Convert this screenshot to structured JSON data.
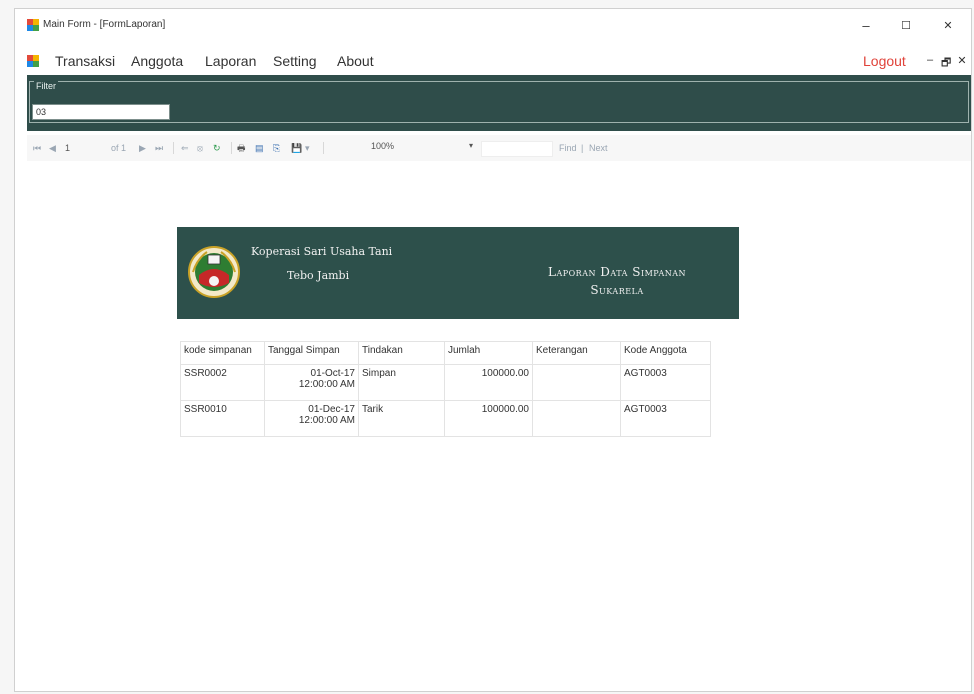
{
  "window": {
    "title": "Main Form - [FormLaporan]",
    "controls": {
      "minimize": "‒",
      "maximize": "☐",
      "close": "✕"
    }
  },
  "menu": {
    "items": [
      "Transaksi",
      "Anggota",
      "Laporan",
      "Setting",
      "About"
    ],
    "logout": "Logout",
    "mdi_controls": [
      "‒",
      "🗗",
      "✕"
    ]
  },
  "filter": {
    "label": "Filter",
    "value": "03"
  },
  "toolbar": {
    "first": "⏮",
    "prev": "◀",
    "page_current": "1",
    "page_of": "of 1",
    "next": "▶",
    "last": "⏭",
    "back": "⇐",
    "stop": "⦻",
    "refresh": "↻",
    "print": "🖶",
    "print_layout": "▤",
    "page_setup": "⎘",
    "export": "💾",
    "zoom": "100%",
    "find_label": "Find",
    "next_label": "Next"
  },
  "report": {
    "org_name": "Koperasi Sari Usaha Tani",
    "org_city": "Tebo Jambi",
    "title_line1": "Laporan Data Simpanan",
    "title_line2": "Sukarela",
    "columns": [
      "kode simpanan",
      "Tanggal Simpan",
      "Tindakan",
      "Jumlah",
      "Keterangan",
      "Kode Anggota"
    ],
    "rows": [
      {
        "kode": "SSR0002",
        "tanggal_date": "01-Oct-17",
        "tanggal_time": "12:00:00 AM",
        "tindakan": "Simpan",
        "jumlah": "100000.00",
        "keterangan": "",
        "anggota": "AGT0003"
      },
      {
        "kode": "SSR0010",
        "tanggal_date": "01-Dec-17",
        "tanggal_time": "12:00:00 AM",
        "tindakan": "Tarik",
        "jumlah": "100000.00",
        "keterangan": "",
        "anggota": "AGT0003"
      }
    ]
  },
  "colors": {
    "panel_bg": "#2f4d4a",
    "banner_bg": "#2d504b",
    "logout": "#e0433a"
  }
}
